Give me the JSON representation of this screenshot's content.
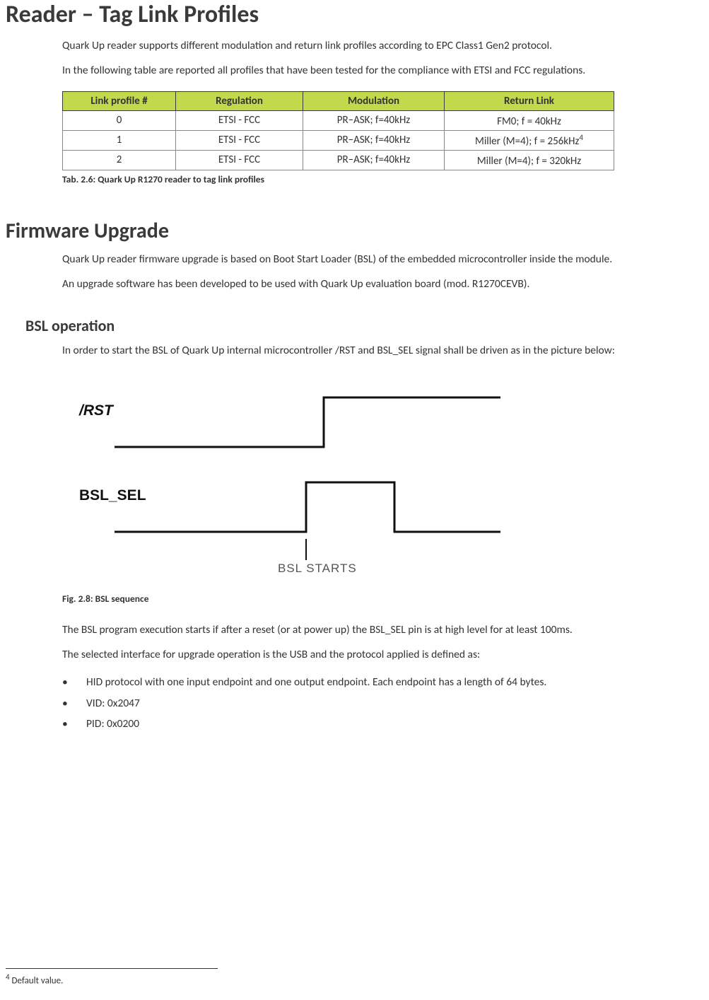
{
  "headings": {
    "h1": "Reader – Tag Link Profiles",
    "h2": "Firmware Upgrade",
    "h3": "BSL operation"
  },
  "paragraphs": {
    "p1": "Quark Up reader supports different modulation and return link profiles according to EPC Class1 Gen2 protocol.",
    "p2": "In the following table are reported all profiles that have been tested for the compliance with ETSI and FCC regulations.",
    "p3": "Quark Up reader firmware upgrade is based on Boot Start Loader (BSL) of the embedded microcontroller inside the module.",
    "p4": "An upgrade software has been developed to be used with Quark Up evaluation board (mod. R1270CEVB).",
    "p5": "In order to start the BSL of Quark Up internal microcontroller /RST and BSL_SEL signal shall be driven as in the picture below:",
    "p6": "The BSL program execution starts if after a reset (or at power up) the BSL_SEL pin is at high level for at least 100ms.",
    "p7": "The selected interface for upgrade operation is the USB and the protocol applied is defined as:"
  },
  "table": {
    "headers": [
      "Link profile #",
      "Regulation",
      "Modulation",
      "Return Link"
    ],
    "rows": [
      {
        "c0": "0",
        "c1": "ETSI - FCC",
        "c2": "PR–ASK; f=40kHz",
        "c3": "FM0; f = 40kHz",
        "sup": ""
      },
      {
        "c0": "1",
        "c1": "ETSI - FCC",
        "c2": "PR–ASK; f=40kHz",
        "c3": "Miller (M=4); f = 256kHz",
        "sup": "4"
      },
      {
        "c0": "2",
        "c1": "ETSI - FCC",
        "c2": "PR–ASK; f=40kHz",
        "c3": "Miller (M=4); f = 320kHz",
        "sup": ""
      }
    ],
    "caption": "Tab. 2.6: Quark Up R1270 reader to tag link profiles"
  },
  "figure": {
    "label_rst": "/RST",
    "label_bsl": "BSL_SEL",
    "label_start": "BSL STARTS",
    "caption": "Fig. 2.8: BSL sequence"
  },
  "bullets": {
    "b1": "HID protocol with one input endpoint and one output endpoint. Each endpoint has a length of 64 bytes.",
    "b2": "VID: 0x2047",
    "b3": "PID: 0x0200"
  },
  "footnote": {
    "num": "4",
    "text": " Default value."
  }
}
